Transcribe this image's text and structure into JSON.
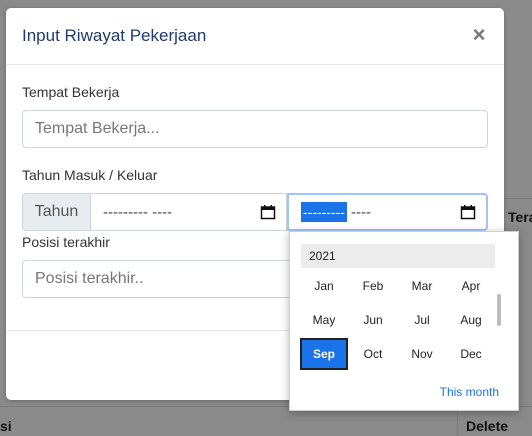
{
  "modal": {
    "title": "Input Riwayat Pekerjaan",
    "close_icon": "×",
    "tempat_label": "Tempat Bekerja",
    "tempat_placeholder": "Tempat Bekerja...",
    "tahun_label": "Tahun Masuk / Keluar",
    "tahun_addon": "Tahun",
    "masuk_value": "--------- ----",
    "keluar_month_segment": "---------",
    "keluar_year_segment": "----",
    "posisi_label": "Posisi terakhir",
    "posisi_placeholder": "Posisi terakhir.."
  },
  "background": {
    "col_fragment_1": "Tera",
    "col_fragment_2": "si",
    "col_fragment_3": "Delete"
  },
  "picker": {
    "year": "2021",
    "months": [
      "Jan",
      "Feb",
      "Mar",
      "Apr",
      "May",
      "Jun",
      "Jul",
      "Aug",
      "Sep",
      "Oct",
      "Nov",
      "Dec"
    ],
    "selected": "Sep",
    "this_month": "This month"
  },
  "icons": {
    "close": "close-icon",
    "calendar": "calendar-icon"
  },
  "colors": {
    "title": "#1f3a6b",
    "accent": "#1a73e8",
    "overlay": "#8a8a8a"
  }
}
